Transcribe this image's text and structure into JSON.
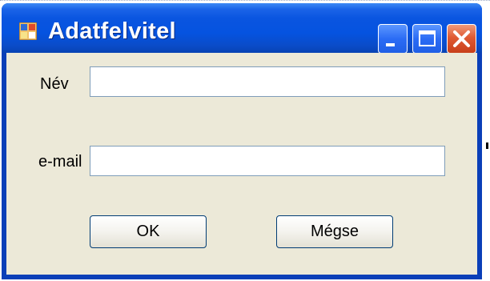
{
  "window": {
    "title": "Adatfelvitel",
    "icon": "app-form-icon",
    "controls": [
      "minimize-icon",
      "maximize-icon",
      "close-icon"
    ]
  },
  "form": {
    "name_label": "Név",
    "name_value": "",
    "email_label": "e-mail",
    "email_value": ""
  },
  "buttons": {
    "ok_label": "OK",
    "cancel_label": "Mégse"
  },
  "colors": {
    "title_bar": "#0553e0",
    "client_bg": "#ece9d8",
    "close_button": "#e05a33"
  }
}
